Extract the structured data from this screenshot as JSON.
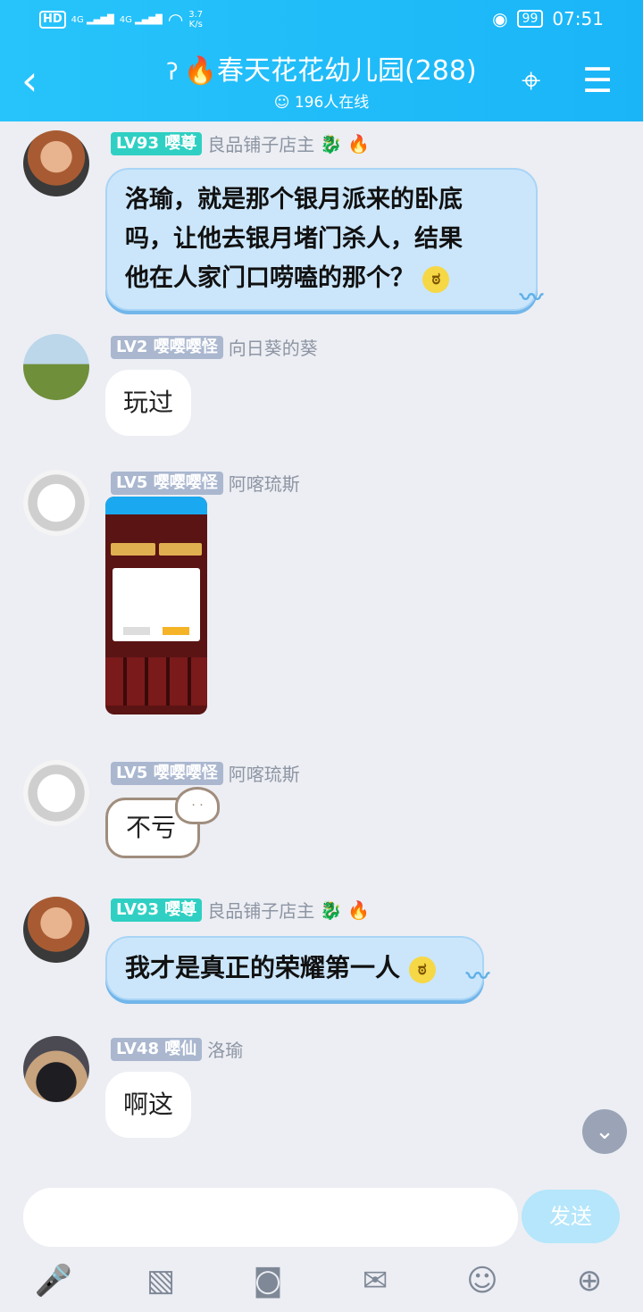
{
  "statusbar": {
    "hd": "HD",
    "signal": "4G",
    "speed": "3.7",
    "speed_unit": "K/s",
    "battery": "99",
    "time": "07:51"
  },
  "header": {
    "title": "春天花花幼儿园(288)",
    "online": "196人在线"
  },
  "messages": [
    {
      "level": "LV93",
      "tag": "嘤尊",
      "name": "良品铺子店主",
      "text_lines": [
        "洛瑜，就是那个银月派来的卧底",
        "吗，让他去银月堵门杀人，结果",
        "他在人家门口唠嗑的那个？"
      ]
    },
    {
      "level": "LV2",
      "tag": "嘤嘤嘤怪",
      "name": "向日葵的葵",
      "text": "玩过"
    },
    {
      "level": "LV5",
      "tag": "嘤嘤嘤怪",
      "name": "阿喀琉斯"
    },
    {
      "level": "LV5",
      "tag": "嘤嘤嘤怪",
      "name": "阿喀琉斯",
      "text": "不亏"
    },
    {
      "level": "LV93",
      "tag": "嘤尊",
      "name": "良品铺子店主",
      "text": "我才是真正的荣耀第一人"
    },
    {
      "level": "LV48",
      "tag": "嘤仙",
      "name": "洛瑜",
      "text": "啊这"
    }
  ],
  "input": {
    "placeholder": "",
    "send_label": "发送"
  },
  "colors": {
    "header": "#1ab5f7",
    "teal_badge": "#2fd0c3",
    "gray_badge": "#aab7cf",
    "bubble_blue": "#cbe6fb"
  }
}
